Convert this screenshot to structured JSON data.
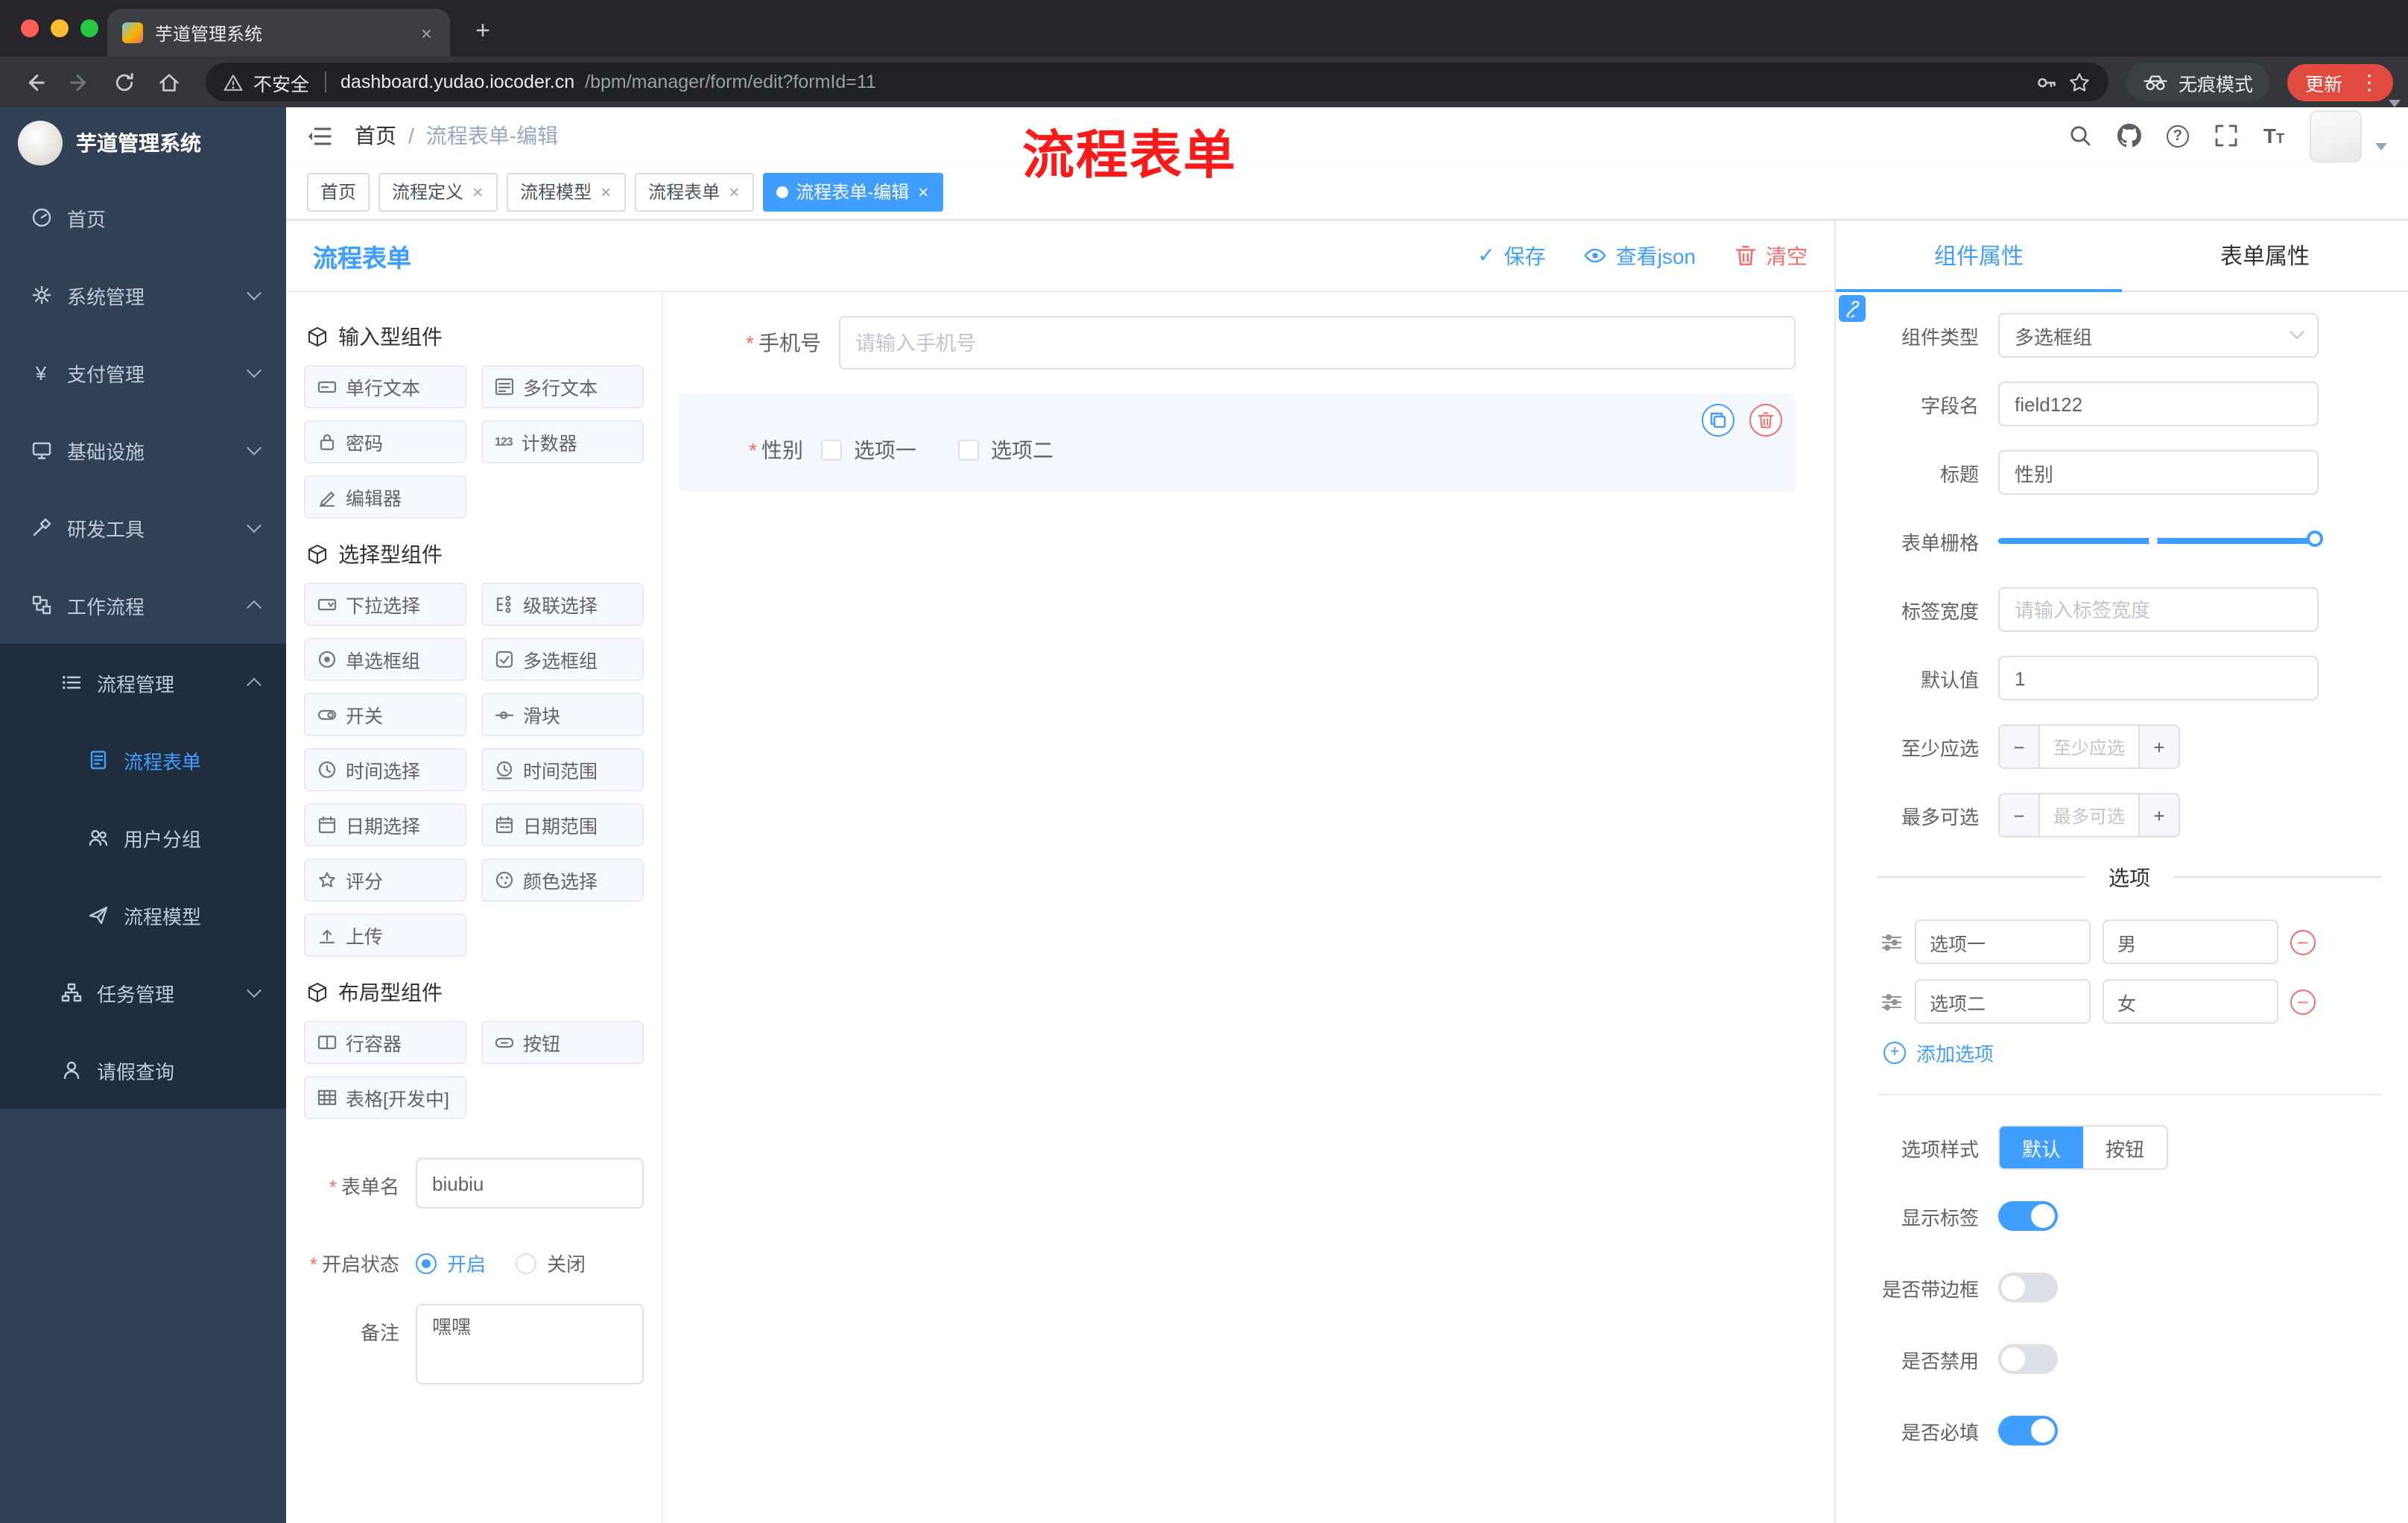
{
  "colors": {
    "primary": "#409eff",
    "danger": "#f56c6c",
    "annotation_red": "#fb1a1a",
    "update_red": "#e04a3f"
  },
  "glyphs": {
    "close": "×",
    "plus": "+",
    "minus": "−",
    "more": "⋮",
    "check": "✓",
    "question": "?",
    "star": "*",
    "counter": "123",
    "yen": "¥",
    "t_large": "T",
    "t_small": "T",
    "slash": "/"
  },
  "browser": {
    "tab_title": "芋道管理系统",
    "security": "不安全",
    "url_host": "dashboard.yudao.iocoder.cn",
    "url_path": "/bpm/manager/form/edit?formId=11",
    "incognito": "无痕模式",
    "update": "更新"
  },
  "sidebar": {
    "title": "芋道管理系统",
    "items": [
      {
        "label": "首页"
      },
      {
        "label": "系统管理"
      },
      {
        "label": "支付管理"
      },
      {
        "label": "基础设施"
      },
      {
        "label": "研发工具"
      },
      {
        "label": "工作流程"
      },
      {
        "label": "流程管理"
      },
      {
        "label": "流程表单"
      },
      {
        "label": "用户分组"
      },
      {
        "label": "流程模型"
      },
      {
        "label": "任务管理"
      },
      {
        "label": "请假查询"
      }
    ]
  },
  "header": {
    "breadcrumb_home": "首页",
    "breadcrumb_current": "流程表单-编辑",
    "annotation": "流程表单"
  },
  "tags": [
    {
      "label": "首页"
    },
    {
      "label": "流程定义"
    },
    {
      "label": "流程模型"
    },
    {
      "label": "流程表单"
    },
    {
      "label": "流程表单-编辑"
    }
  ],
  "designer": {
    "panel_title": "流程表单",
    "actions": {
      "save": "保存",
      "view_json": "查看json",
      "clear": "清空"
    },
    "palette": {
      "groups": [
        {
          "title": "输入型组件",
          "items": [
            "单行文本",
            "多行文本",
            "密码",
            "计数器",
            "编辑器"
          ]
        },
        {
          "title": "选择型组件",
          "items": [
            "下拉选择",
            "级联选择",
            "单选框组",
            "多选框组",
            "开关",
            "滑块",
            "时间选择",
            "时间范围",
            "日期选择",
            "日期范围",
            "评分",
            "颜色选择",
            "上传"
          ]
        },
        {
          "title": "布局型组件",
          "items": [
            "行容器",
            "按钮",
            "表格[开发中]"
          ]
        }
      ]
    },
    "meta": {
      "name_label": "表单名",
      "name_value": "biubiu",
      "status_label": "开启状态",
      "status_on": "开启",
      "status_off": "关闭",
      "remark_label": "备注",
      "remark_value": "嘿嘿"
    },
    "canvas": {
      "phone_label": "手机号",
      "phone_placeholder": "请输入手机号",
      "gender_label": "性别",
      "gender_option1": "选项一",
      "gender_option2": "选项二"
    }
  },
  "props": {
    "tab_component": "组件属性",
    "tab_form": "表单属性",
    "component_type_label": "组件类型",
    "component_type_value": "多选框组",
    "field_label": "字段名",
    "field_value": "field122",
    "title_label": "标题",
    "title_value": "性别",
    "grid_label": "表单栅格",
    "label_width_label": "标签宽度",
    "label_width_placeholder": "请输入标签宽度",
    "default_label": "默认值",
    "default_value": "1",
    "min_label": "至少应选",
    "min_placeholder": "至少应选",
    "max_label": "最多可选",
    "max_placeholder": "最多可选",
    "options_title": "选项",
    "options": [
      {
        "label": "选项一",
        "value": "男"
      },
      {
        "label": "选项二",
        "value": "女"
      }
    ],
    "add_option": "添加选项",
    "style_label": "选项样式",
    "style_default": "默认",
    "style_button": "按钮",
    "toggle_show_label": "显示标签",
    "toggle_border": "是否带边框",
    "toggle_disabled": "是否禁用",
    "toggle_required": "是否必填"
  }
}
